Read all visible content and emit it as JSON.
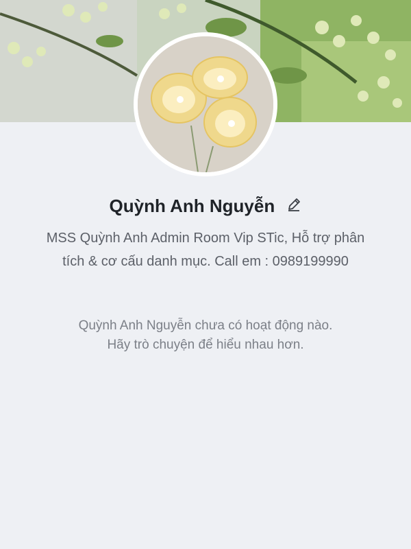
{
  "profile": {
    "display_name": "Quỳnh Anh Nguyễn",
    "bio_line1": "MSS Quỳnh Anh Admin Room Vip STic, Hỗ trợ phân",
    "bio_line2": "tích & cơ cấu danh mục. Call em : 0989199990"
  },
  "feed": {
    "empty_line1": "Quỳnh Anh Nguyễn chưa có hoạt động nào.",
    "empty_line2": "Hãy trò chuyện để hiểu nhau hơn."
  },
  "icons": {
    "edit": "pencil-icon"
  },
  "colors": {
    "background": "#eef0f4",
    "name_text": "#1f2328",
    "bio_text": "#5c6068",
    "muted_text": "#7b7f87"
  }
}
